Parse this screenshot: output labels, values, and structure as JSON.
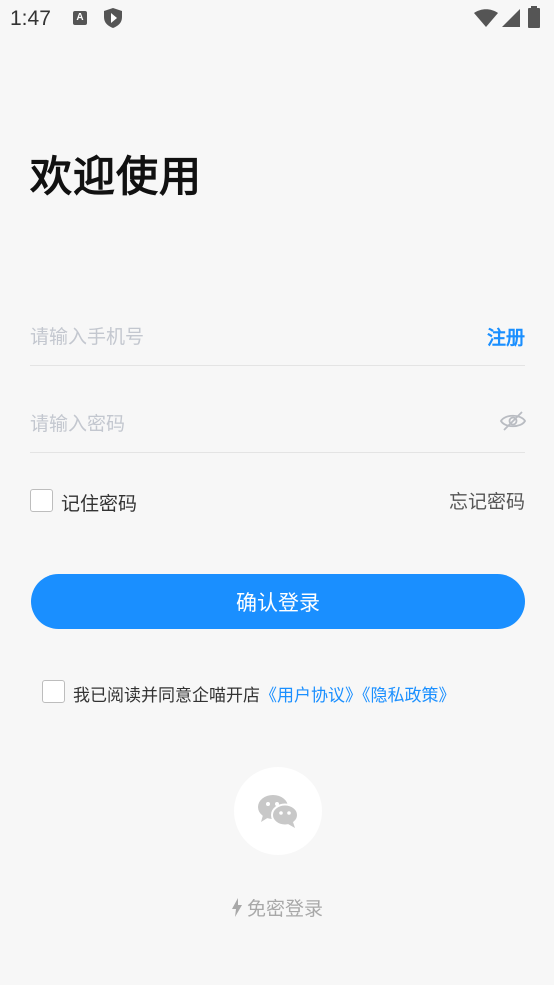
{
  "status_bar": {
    "time": "1:47",
    "notification_icons": [
      "a-app-icon",
      "shield-icon"
    ],
    "system_icons": [
      "wifi-icon",
      "signal-icon",
      "battery-icon"
    ]
  },
  "page": {
    "title": "欢迎使用"
  },
  "login_form": {
    "phone_placeholder": "请输入手机号",
    "phone_value": "",
    "register_label": "注册",
    "password_placeholder": "请输入密码",
    "password_value": "",
    "password_visibility_icon": "eye-off-icon",
    "remember_label": "记住密码",
    "remember_checked": false,
    "forgot_label": "忘记密码",
    "submit_label": "确认登录"
  },
  "agreement": {
    "checked": false,
    "text": "我已阅读并同意企喵开店",
    "user_agreement_label": "《用户协议》",
    "privacy_policy_label": "《隐私政策》"
  },
  "alt_login": {
    "wechat_icon": "wechat-icon",
    "quick_login_label": "免密登录",
    "quick_login_icon": "lightning-icon"
  },
  "colors": {
    "accent": "#1a8fff",
    "background": "#f7f7f7",
    "placeholder": "#c3c7cf",
    "muted": "#a8a8a8"
  }
}
